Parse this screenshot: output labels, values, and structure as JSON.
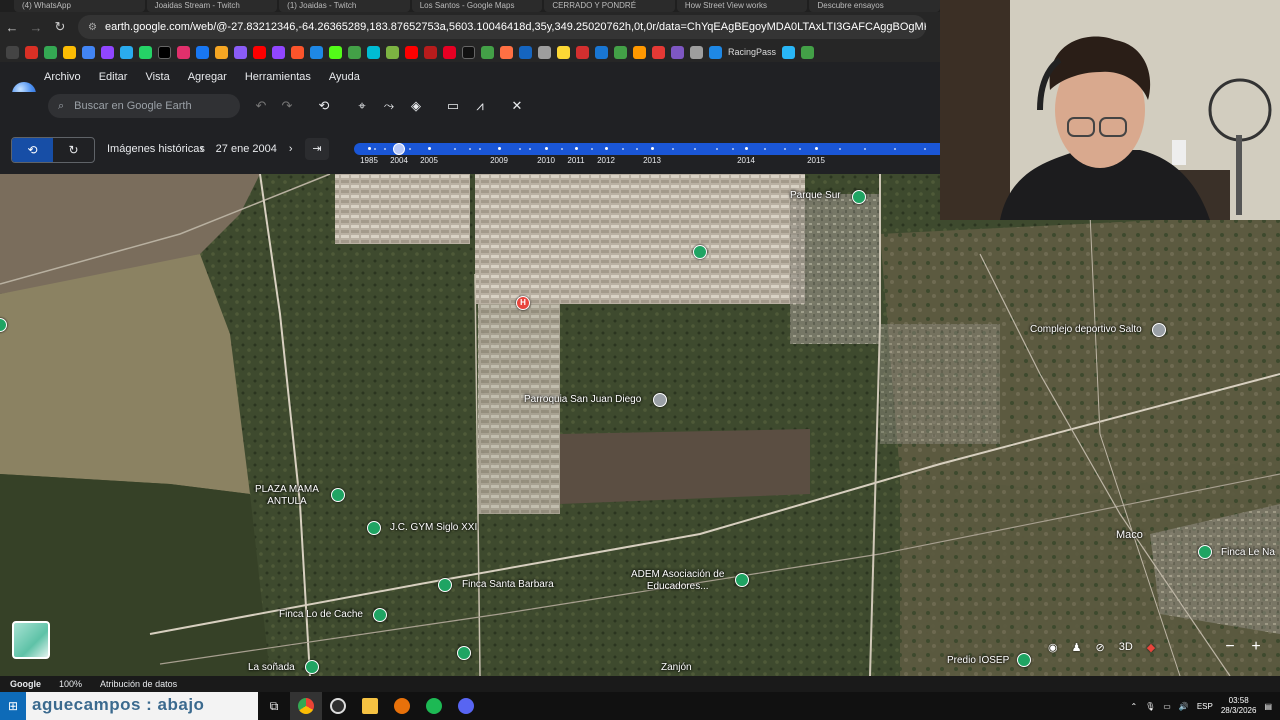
{
  "browser": {
    "tabs": [
      "(4) WhatsApp",
      "Joaidas Stream - Twitch",
      "(1) Joaidas - Twitch",
      "Los Santos - Google Maps",
      "CERRADO Y PONDRÉ",
      "How Street View works",
      "Descubre ensayos"
    ],
    "url": "earth.google.com/web/@-27.83212346,-64.26365289,183.87652753a,5603.10046418d,35y,349.25020762h,0t,0r/data=ChYqEAgBEgoyMDA0LTAxLTI3GAFCAggBOgMKATBCAggASgQI________ARAA",
    "bookmark_label": "RacingPass"
  },
  "menu": {
    "items": [
      "Archivo",
      "Editar",
      "Vista",
      "Agregar",
      "Herramientas",
      "Ayuda"
    ]
  },
  "search": {
    "placeholder": "Buscar en Google Earth"
  },
  "history": {
    "label": "Imágenes históricas",
    "date": "27 ene 2004",
    "years": [
      "1985",
      "2004",
      "2005",
      "2009",
      "2010",
      "2011",
      "2012",
      "2013",
      "2014",
      "2015"
    ]
  },
  "places": {
    "parque_sur": "Parque Sur",
    "complejo": "Complejo deportivo Salto",
    "parroquia": "Parroquia San Juan Diego",
    "plaza_l1": "PLAZA MAMA",
    "plaza_l2": "ANTULA",
    "gym": "J.C. GYM Siglo XXI",
    "finca_santa": "Finca Santa Barbara",
    "adem_l1": "ADEM Asociación de",
    "adem_l2": "Educadores...",
    "finca_lo": "Finca Lo de Cache",
    "maco": "Maco",
    "finca_le": "Finca Le Na",
    "la_sonada": "La soñada",
    "zanjon": "Zanjón",
    "predio": "Predio IOSEP",
    "hospital_letter": "H"
  },
  "map_controls": {
    "mode_3d": "3D"
  },
  "status": {
    "brand": "Google",
    "zoom": "100%",
    "attribution": "Atribución de datos"
  },
  "taskbar": {
    "overlay_text": "aguecampos : abajo",
    "lang": "ESP",
    "time": "03:58",
    "date": "28/3/2026"
  }
}
